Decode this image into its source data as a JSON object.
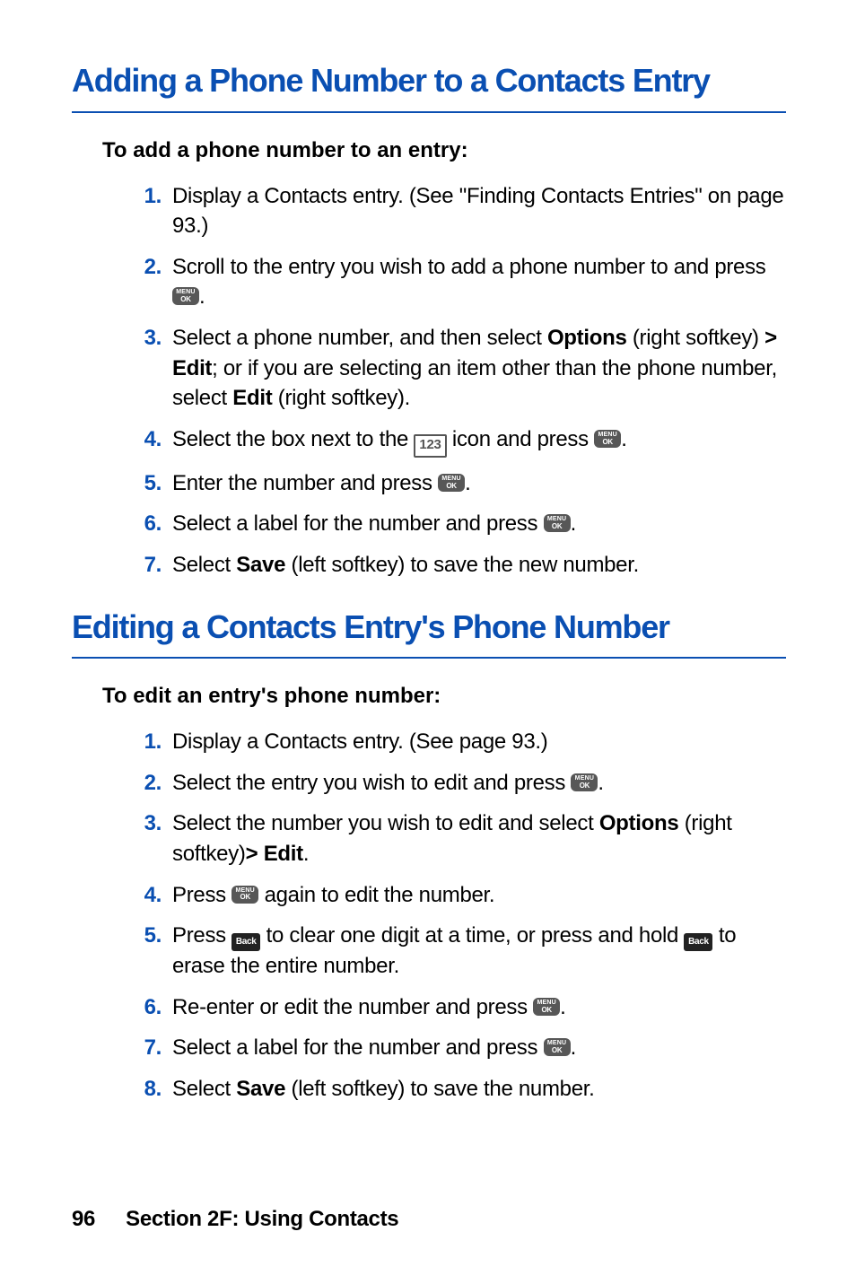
{
  "headings": {
    "h1a": "Adding a Phone Number to a Contacts Entry",
    "h1b": "Editing a Contacts Entry's Phone Number"
  },
  "introA": "To add a phone number to an entry:",
  "introB": "To edit an entry's phone number:",
  "stepsA": {
    "s1": "Display a Contacts entry. (See \"Finding Contacts Entries\" on page 93.)",
    "s2a": "Scroll to the entry you wish to add a phone number to and press ",
    "s3a": "Select a phone number, and then select ",
    "s3_options": "Options",
    "s3b": " (right softkey) ",
    "s3_gt": "> ",
    "s3_edit": "Edit",
    "s3c": "; or if you are selecting an item other than the phone number, select ",
    "s3_edit2": "Edit",
    "s3d": " (right softkey).",
    "s4a": "Select the box next to the ",
    "s4b": " icon and press ",
    "s5a": "Enter the number and press ",
    "s6a": "Select a label for the number and press ",
    "s7a": "Select ",
    "s7_save": "Save",
    "s7b": " (left softkey) to save the new number."
  },
  "stepsB": {
    "s1": "Display a Contacts entry. (See page 93.)",
    "s2a": "Select the entry you wish to edit and press ",
    "s3a": "Select the number you wish to edit and select ",
    "s3_options": "Options",
    "s3b": " (right softkey)",
    "s3_gt": "> ",
    "s3_edit": "Edit",
    "s3c": ".",
    "s4a": "Press ",
    "s4b": " again to edit the number.",
    "s5a": "Press ",
    "s5b": " to clear one digit at a time, or press and hold ",
    "s5c": " to erase the entire number.",
    "s6a": "Re-enter or edit the number and press ",
    "s7a": "Select a label for the number and press ",
    "s8a": "Select ",
    "s8_save": "Save",
    "s8b": " (left softkey) to save the number."
  },
  "period": ".",
  "footer": {
    "page": "96",
    "section": "Section 2F: Using Contacts"
  }
}
